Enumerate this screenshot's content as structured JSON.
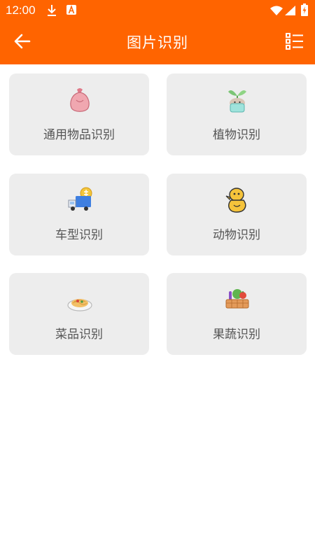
{
  "status_bar": {
    "time": "12:00",
    "icons": [
      "download-icon",
      "a-badge-icon",
      "wifi-icon",
      "cellular-signal-icon",
      "battery-charging-icon"
    ]
  },
  "app_bar": {
    "title": "图片识别",
    "back_icon": "arrow-left-icon",
    "history_icon": "list-icon",
    "color": "#ff6400"
  },
  "categories": [
    {
      "label": "通用物品识别",
      "icon": "pink-bag-icon"
    },
    {
      "label": "植物识别",
      "icon": "sprout-pot-icon"
    },
    {
      "label": "车型识别",
      "icon": "truck-icon"
    },
    {
      "label": "动物识别",
      "icon": "yellow-duck-icon"
    },
    {
      "label": "菜品识别",
      "icon": "pasta-plate-icon"
    },
    {
      "label": "果蔬识别",
      "icon": "vegetable-basket-icon"
    }
  ]
}
